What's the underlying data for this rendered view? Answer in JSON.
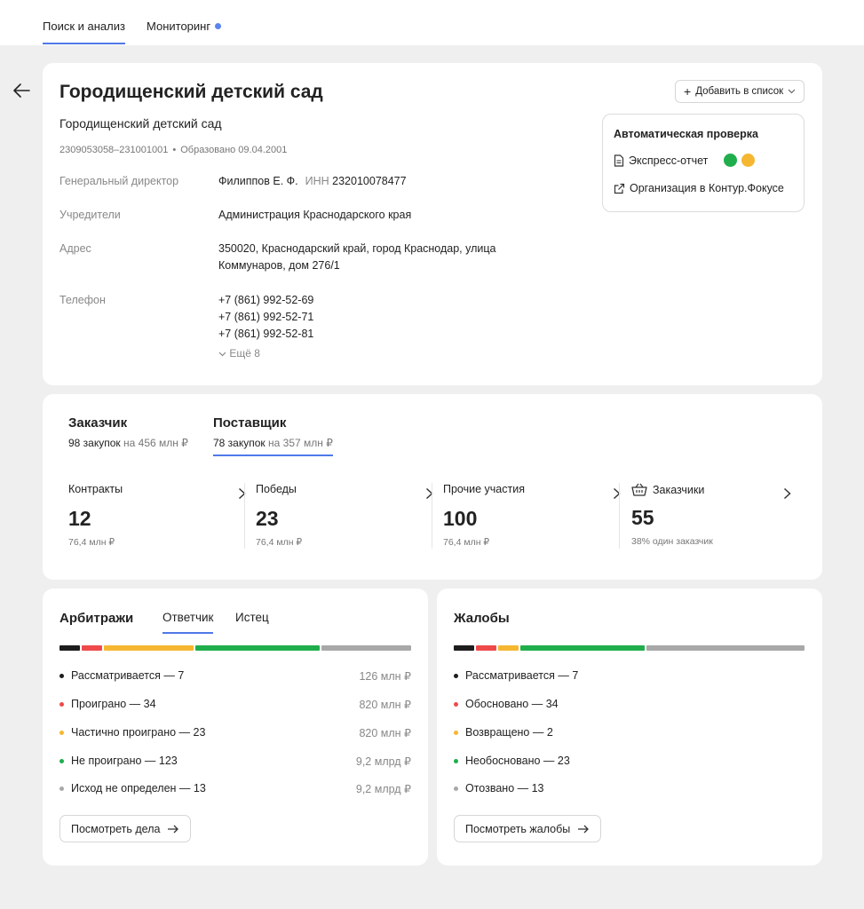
{
  "nav": {
    "tabs": [
      {
        "label": "Поиск и анализ"
      },
      {
        "label": "Мониторинг"
      }
    ]
  },
  "company": {
    "name": "Городищенский детский сад",
    "short_name": "Городищенский детский сад",
    "codes": "2309053058–231001001",
    "founded": "Образовано 09.04.2001",
    "director_label": "Генеральный директор",
    "director": "Филиппов Е. Ф.",
    "inn_label": "ИНН",
    "inn": "232010078477",
    "founders_label": "Учредители",
    "founders": "Администрация Краснодарского края",
    "address_label": "Адрес",
    "address_line1": "350020, Краснодарский край, город Краснодар, улица",
    "address_line2": "Коммунаров, дом 276/1",
    "phone_label": "Телефон",
    "phones": [
      "+7 (861) 992-52-69",
      "+7 (861) 992-52-71",
      "+7 (861) 992-52-81"
    ],
    "more_phones": "Ещё 8",
    "add_to_list": "Добавить в список",
    "auto_check": {
      "title": "Автоматическая проверка",
      "express": "Экспресс-отчет",
      "light_colors": [
        "#1fae4b",
        "#f5b731"
      ],
      "focus_link": "Организация в Контур.Фокусе"
    }
  },
  "procurement": {
    "roles": [
      {
        "title": "Заказчик",
        "count": "98 закупок",
        "sum": "на 456 млн ₽"
      },
      {
        "title": "Поставщик",
        "count": "78 закупок",
        "sum": "на 357 млн ₽"
      }
    ],
    "stats": [
      {
        "label": "Контракты",
        "value": "12",
        "sub": "76,4 млн ₽"
      },
      {
        "label": "Победы",
        "value": "23",
        "sub": "76,4 млн ₽"
      },
      {
        "label": "Прочие участия",
        "value": "100",
        "sub": "76,4 млн ₽"
      },
      {
        "label": "Заказчики",
        "value": "55",
        "sub": "38% один заказчик"
      }
    ]
  },
  "arbitration": {
    "title": "Арбитражи",
    "tabs": [
      "Ответчик",
      "Истец"
    ],
    "items": [
      {
        "label": "Рассматривается — 7",
        "amount": "126 млн ₽",
        "color": "#1d1d1d",
        "share": 0.06
      },
      {
        "label": "Проиграно — 34",
        "amount": "820 млн ₽",
        "color": "#ef4a4a",
        "share": 0.06
      },
      {
        "label": "Частично проиграно — 23",
        "amount": "820 млн ₽",
        "color": "#f5b731",
        "share": 0.26
      },
      {
        "label": "Не проиграно — 123",
        "amount": "9,2 млрд ₽",
        "color": "#1fae4b",
        "share": 0.36
      },
      {
        "label": "Исход не определен — 13",
        "amount": "9,2 млрд ₽",
        "color": "#a8a8a8",
        "share": 0.26
      }
    ],
    "button": "Посмотреть дела"
  },
  "complaints": {
    "title": "Жалобы",
    "items": [
      {
        "label": "Рассматривается — 7",
        "color": "#1d1d1d",
        "share": 0.06
      },
      {
        "label": "Обосновано — 34",
        "color": "#ef4a4a",
        "share": 0.06
      },
      {
        "label": "Возвращено — 2",
        "color": "#f5b731",
        "share": 0.06
      },
      {
        "label": "Необосновано — 23",
        "color": "#1fae4b",
        "share": 0.36
      },
      {
        "label": "Отозвано — 13",
        "color": "#a8a8a8",
        "share": 0.46
      }
    ],
    "button": "Посмотреть жалобы"
  }
}
